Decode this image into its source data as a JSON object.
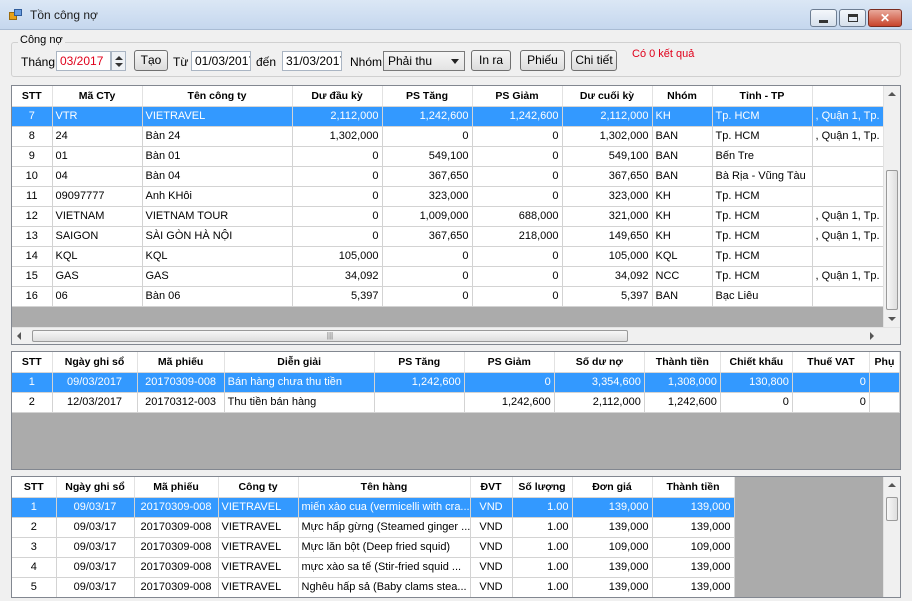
{
  "window": {
    "title": "Tồn công nợ"
  },
  "filter": {
    "group_label": "Công nợ",
    "month_label": "Tháng",
    "month_value": "03/2017",
    "create_button": "Tạo",
    "from_label": "Từ",
    "from_value": "01/03/2017",
    "to_label": "đến",
    "to_value": "31/03/2017",
    "group_filter_label": "Nhóm",
    "group_select_value": "Phải thu",
    "print_button": "In ra",
    "voucher_button": "Phiếu",
    "detail_button": "Chi tiết",
    "result_text": "Có 0 kết quả"
  },
  "colors": {
    "selection": "#3399ff",
    "alert": "#e0001b"
  },
  "summary_grid": {
    "headers": [
      "STT",
      "Mã CTy",
      "Tên công ty",
      "Dư đầu kỳ",
      "PS Tăng",
      "PS Giảm",
      "Dư cuối kỳ",
      "Nhóm",
      "Tỉnh - TP",
      ""
    ],
    "rows": [
      [
        "7",
        "VTR",
        "VIETRAVEL",
        "2,112,000",
        "1,242,600",
        "1,242,600",
        "2,112,000",
        "KH",
        "Tp. HCM",
        ", Quận 1, Tp."
      ],
      [
        "8",
        "24",
        "Bàn 24",
        "1,302,000",
        "0",
        "0",
        "1,302,000",
        "BAN",
        "Tp. HCM",
        ", Quận 1, Tp."
      ],
      [
        "9",
        "01",
        "Bàn 01",
        "0",
        "549,100",
        "0",
        "549,100",
        "BAN",
        "Bến Tre",
        ""
      ],
      [
        "10",
        "04",
        "Bàn 04",
        "0",
        "367,650",
        "0",
        "367,650",
        "BAN",
        "Bà Rịa - Vũng Tàu",
        ""
      ],
      [
        "11",
        "09097777",
        "Anh KHôi",
        "0",
        "323,000",
        "0",
        "323,000",
        "KH",
        "Tp. HCM",
        ""
      ],
      [
        "12",
        "VIETNAM",
        "VIETNAM TOUR",
        "0",
        "1,009,000",
        "688,000",
        "321,000",
        "KH",
        "Tp. HCM",
        ", Quận 1, Tp."
      ],
      [
        "13",
        "SAIGON",
        "SÀI GÒN HÀ NỘI",
        "0",
        "367,650",
        "218,000",
        "149,650",
        "KH",
        "Tp. HCM",
        ", Quận 1, Tp."
      ],
      [
        "14",
        "KQL",
        "KQL",
        "105,000",
        "0",
        "0",
        "105,000",
        "KQL",
        "Tp. HCM",
        ""
      ],
      [
        "15",
        "GAS",
        "GAS",
        "34,092",
        "0",
        "0",
        "34,092",
        "NCC",
        "Tp. HCM",
        ", Quận 1, Tp."
      ],
      [
        "16",
        "06",
        "Bàn 06",
        "5,397",
        "0",
        "0",
        "5,397",
        "BAN",
        "Bạc Liêu",
        ""
      ]
    ],
    "selected_index": 0
  },
  "voucher_grid": {
    "headers": [
      "STT",
      "Ngày ghi sổ",
      "Mã phiếu",
      "Diễn giải",
      "PS Tăng",
      "PS Giảm",
      "Số dư nợ",
      "Thành tiền",
      "Chiết khấu",
      "Thuế VAT",
      "Phụ"
    ],
    "rows": [
      [
        "1",
        "09/03/2017",
        "20170309-008",
        "Bán hàng chưa thu tiền",
        "1,242,600",
        "0",
        "3,354,600",
        "1,308,000",
        "130,800",
        "0",
        ""
      ],
      [
        "2",
        "12/03/2017",
        "20170312-003",
        "Thu tiền bán hàng",
        "",
        "1,242,600",
        "2,112,000",
        "1,242,600",
        "0",
        "0",
        ""
      ]
    ],
    "selected_index": 0
  },
  "detail_grid": {
    "headers": [
      "STT",
      "Ngày ghi sổ",
      "Mã phiếu",
      "Công ty",
      "Tên hàng",
      "ĐVT",
      "Số lượng",
      "Đơn giá",
      "Thành tiền"
    ],
    "rows": [
      [
        "1",
        "09/03/17",
        "20170309-008",
        "VIETRAVEL",
        "miến xào cua (vermicelli with cra...",
        "VND",
        "1.00",
        "139,000",
        "139,000"
      ],
      [
        "2",
        "09/03/17",
        "20170309-008",
        "VIETRAVEL",
        "Mực hấp gừng (Steamed ginger ...",
        "VND",
        "1.00",
        "139,000",
        "139,000"
      ],
      [
        "3",
        "09/03/17",
        "20170309-008",
        "VIETRAVEL",
        "Mực lăn bột (Deep fried squid)",
        "VND",
        "1.00",
        "109,000",
        "109,000"
      ],
      [
        "4",
        "09/03/17",
        "20170309-008",
        "VIETRAVEL",
        "mực xào sa tế (Stir-fried squid ...",
        "VND",
        "1.00",
        "139,000",
        "139,000"
      ],
      [
        "5",
        "09/03/17",
        "20170309-008",
        "VIETRAVEL",
        "Nghêu hấp sả (Baby clams stea...",
        "VND",
        "1.00",
        "139,000",
        "139,000"
      ]
    ],
    "selected_index": 0
  }
}
